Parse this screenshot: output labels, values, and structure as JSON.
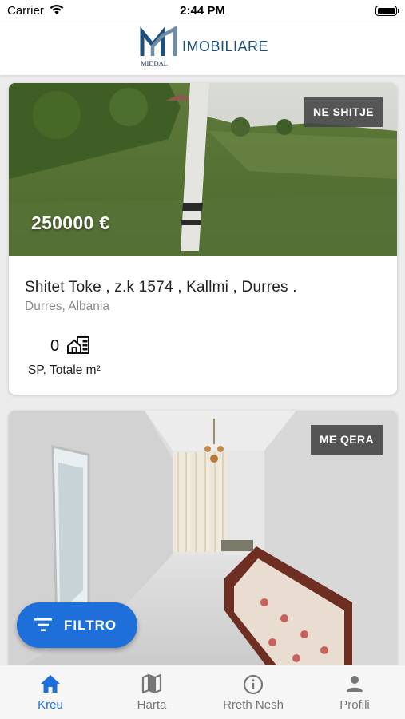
{
  "status_bar": {
    "carrier": "Carrier",
    "time": "2:44 PM"
  },
  "header": {
    "brand_name": "IMOBILIARE",
    "logo_text": "MIDDAL"
  },
  "listings": [
    {
      "badge": "NE SHITJE",
      "price": "250000 €",
      "title": "Shitet Toke , z.k 1574 , Kallmi , Durres .",
      "location": "Durres, Albania",
      "area_value": "0",
      "area_label": "SP. Totale m²"
    },
    {
      "badge": "ME QERA"
    }
  ],
  "filter_button": {
    "label": "FILTRO"
  },
  "bottom_nav": {
    "items": [
      {
        "label": "Kreu",
        "icon": "home-icon",
        "active": true
      },
      {
        "label": "Harta",
        "icon": "map-icon",
        "active": false
      },
      {
        "label": "Rreth Nesh",
        "icon": "info-icon",
        "active": false
      },
      {
        "label": "Profili",
        "icon": "person-icon",
        "active": false
      }
    ]
  },
  "colors": {
    "accent": "#1e6fd9",
    "brand": "#1e4f7a",
    "badge_bg": "#464646"
  }
}
